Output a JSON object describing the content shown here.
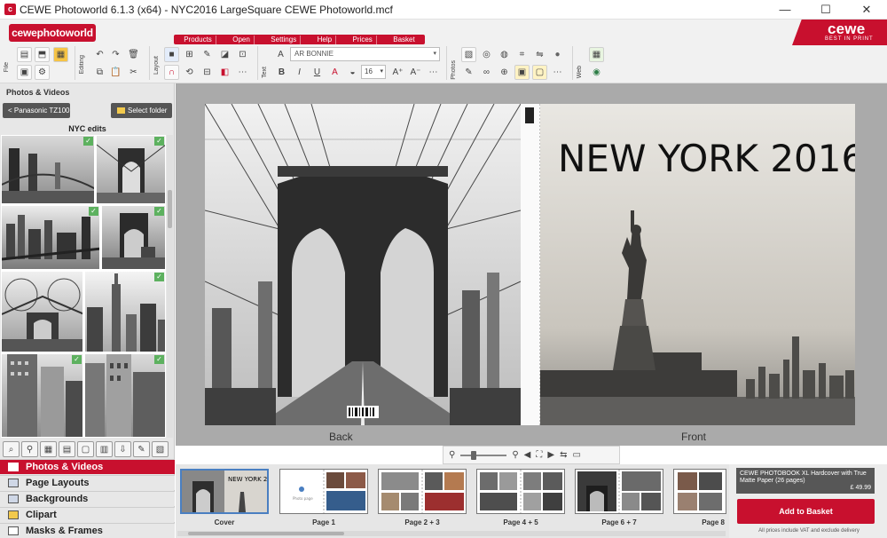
{
  "titlebar": {
    "title": "CEWE Photoworld 6.1.3 (x64) - NYC2016 LargeSquare CEWE Photoworld.mcf",
    "minimize": "—",
    "maximize": "☐",
    "close": "✕"
  },
  "brand": {
    "logo_text": "cewephotoworld",
    "corner_name": "cewe",
    "corner_tagline": "BEST IN PRINT"
  },
  "menu": [
    "Products",
    "Open",
    "Settings",
    "Help",
    "Prices",
    "Basket"
  ],
  "ribbon_groups": {
    "file": "File",
    "editing": "Editing",
    "layout": "Layout",
    "text": "Text",
    "photos": "Photos",
    "web": "Web"
  },
  "text_toolbar": {
    "font": "AR BONNIE",
    "size": "16",
    "font_dropdown": "▾",
    "size_dropdown": "▾"
  },
  "sidebar": {
    "title": "Photos & Videos",
    "back_button": "Panasonic TZ100",
    "back_chevron": "<",
    "select_folder_button": "Select folder",
    "album_title": "NYC edits",
    "accordion": [
      {
        "label": "Photos & Videos",
        "active": true
      },
      {
        "label": "Page Layouts",
        "active": false
      },
      {
        "label": "Backgrounds",
        "active": false
      },
      {
        "label": "Clipart",
        "active": false
      },
      {
        "label": "Masks & Frames",
        "active": false
      }
    ]
  },
  "spread": {
    "cover_title": "NEW YORK 2016",
    "back_label": "Back",
    "front_label": "Front"
  },
  "filmstrip": {
    "pages": [
      {
        "label": "Cover",
        "selected": true
      },
      {
        "label": "Page 1",
        "selected": false
      },
      {
        "label": "Page 2 + 3",
        "selected": false
      },
      {
        "label": "Page 4 + 5",
        "selected": false
      },
      {
        "label": "Page 6 + 7",
        "selected": false
      },
      {
        "label": "Page 8",
        "selected": false
      }
    ],
    "page1_caption": "Photo page"
  },
  "product": {
    "description": "CEWE PHOTOBOOK XL Hardcover with True Matte Paper (26 pages)",
    "price": "£ 49.99",
    "add_to_basket": "Add to Basket",
    "vat_note": "All prices include VAT and exclude delivery"
  },
  "colors": {
    "brand_red": "#c8102e",
    "check_green": "#5db15f"
  }
}
